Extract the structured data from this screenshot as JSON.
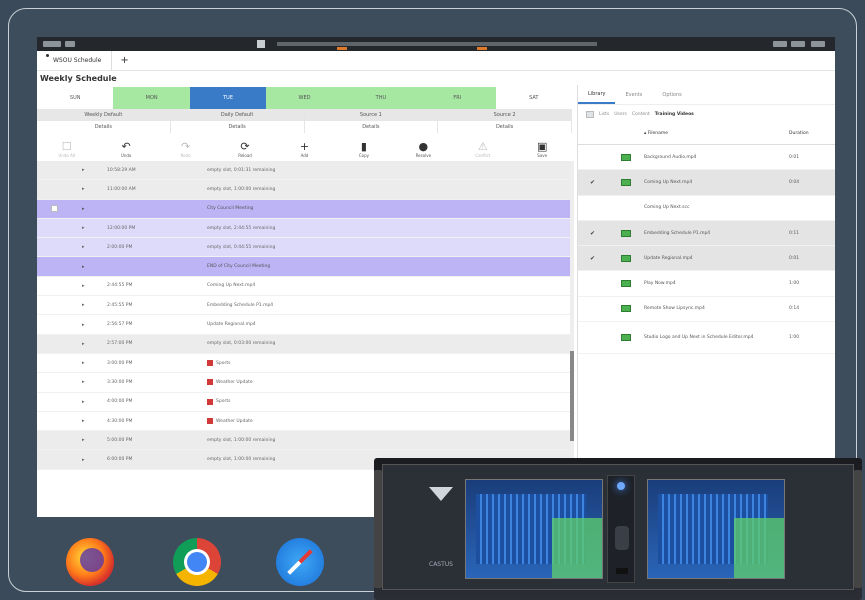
{
  "app": {
    "tab_label": "WSOU Schedule",
    "new_tab": "+",
    "title": "Weekly Schedule"
  },
  "days": [
    {
      "label": "SUN",
      "style": "plain"
    },
    {
      "label": "MON",
      "style": "green"
    },
    {
      "label": "TUE",
      "style": "blue"
    },
    {
      "label": "WED",
      "style": "green"
    },
    {
      "label": "THU",
      "style": "green"
    },
    {
      "label": "FRI",
      "style": "green"
    },
    {
      "label": "SAT",
      "style": "plain"
    }
  ],
  "channels_row1": [
    "Weekly Default",
    "Daily Default",
    "Source 1",
    "Source 2"
  ],
  "channels_row2": [
    "Details",
    "Details",
    "Details",
    "Details"
  ],
  "toolbar": [
    {
      "label": "Undo All",
      "icon": "☐",
      "disabled": true
    },
    {
      "label": "Undo",
      "icon": "↶",
      "disabled": false
    },
    {
      "label": "Redo",
      "icon": "↷",
      "disabled": true
    },
    {
      "label": "Reload",
      "icon": "⟳",
      "disabled": false
    },
    {
      "label": "Add",
      "icon": "+",
      "disabled": false
    },
    {
      "label": "Copy",
      "icon": "▮",
      "disabled": false
    },
    {
      "label": "Resolve",
      "icon": "●",
      "disabled": false
    },
    {
      "label": "Conflict",
      "icon": "⚠",
      "disabled": true
    },
    {
      "label": "Save",
      "icon": "▣",
      "disabled": false
    }
  ],
  "schedule_rows": [
    {
      "time": "10:58:29 AM",
      "desc": "empty slot, 0:01:31 remaining",
      "style": "gray",
      "red": false
    },
    {
      "time": "11:00:00 AM",
      "desc": "empty slot, 1:00:00 remaining",
      "style": "gray",
      "red": false
    },
    {
      "time": "",
      "desc": "City Council Meeting",
      "style": "purple",
      "red": false,
      "check": true
    },
    {
      "time": "12:00:00 PM",
      "desc": "empty slot, 2:44:55 remaining",
      "style": "lpurple",
      "red": false
    },
    {
      "time": "2:00:00 PM",
      "desc": "empty slot, 0:44:55 remaining",
      "style": "lpurple",
      "red": false
    },
    {
      "time": "",
      "desc": "END of City Council Meeting",
      "style": "purple",
      "red": false
    },
    {
      "time": "2:44:55 PM",
      "desc": "Coming Up Next.mp4",
      "style": "",
      "red": false
    },
    {
      "time": "2:45:55 PM",
      "desc": "Embedding Schedule P1.mp4",
      "style": "",
      "red": false
    },
    {
      "time": "2:56:57 PM",
      "desc": "Update Regional.mp4",
      "style": "",
      "red": false
    },
    {
      "time": "2:57:00 PM",
      "desc": "empty slot, 0:03:00 remaining",
      "style": "gray",
      "red": false
    },
    {
      "time": "3:00:00 PM",
      "desc": "Sports",
      "style": "",
      "red": true
    },
    {
      "time": "3:30:00 PM",
      "desc": "Weather Update",
      "style": "",
      "red": true
    },
    {
      "time": "4:00:00 PM",
      "desc": "Sports",
      "style": "",
      "red": true
    },
    {
      "time": "4:30:00 PM",
      "desc": "Weather Update",
      "style": "",
      "red": true
    },
    {
      "time": "5:00:00 PM",
      "desc": "empty slot, 1:00:00 remaining",
      "style": "gray",
      "red": false
    },
    {
      "time": "6:00:00 PM",
      "desc": "empty slot, 1:00:00 remaining",
      "style": "gray",
      "red": false
    }
  ],
  "right_panel": {
    "tabs": [
      "Library",
      "Events",
      "Options"
    ],
    "breadcrumb": [
      "Lists",
      "Users",
      "Content"
    ],
    "current_folder": "Training Videos",
    "col_filename": "Filename",
    "col_duration": "Duration",
    "files": [
      {
        "name": "Background Audio.mp4",
        "duration": "0:01",
        "checked": false,
        "style": "",
        "icon": true
      },
      {
        "name": "Coming Up Next.mp4",
        "duration": "0:04",
        "checked": true,
        "style": "gray",
        "icon": true
      },
      {
        "name": "Coming Up Next.scc",
        "duration": "",
        "checked": false,
        "style": "",
        "icon": false
      },
      {
        "name": "Embedding Schedule P1.mp4",
        "duration": "0:11",
        "checked": true,
        "style": "gray",
        "icon": true
      },
      {
        "name": "Update Regional.mp4",
        "duration": "0:01",
        "checked": true,
        "style": "gray",
        "icon": true
      },
      {
        "name": "Play Now.mp4",
        "duration": "1:00",
        "checked": false,
        "style": "",
        "icon": true
      },
      {
        "name": "Remote Show Lipsync.mp4",
        "duration": "0:14",
        "checked": false,
        "style": "",
        "icon": true
      },
      {
        "name": "Studio Logo and Up Next in Schedule Editor.mp4",
        "duration": "1:00",
        "checked": false,
        "style": "",
        "icon": true,
        "tall": true
      }
    ]
  },
  "device": {
    "brand": "CASTUS"
  },
  "dock": [
    "firefox-icon",
    "chrome-icon",
    "safari-icon"
  ]
}
